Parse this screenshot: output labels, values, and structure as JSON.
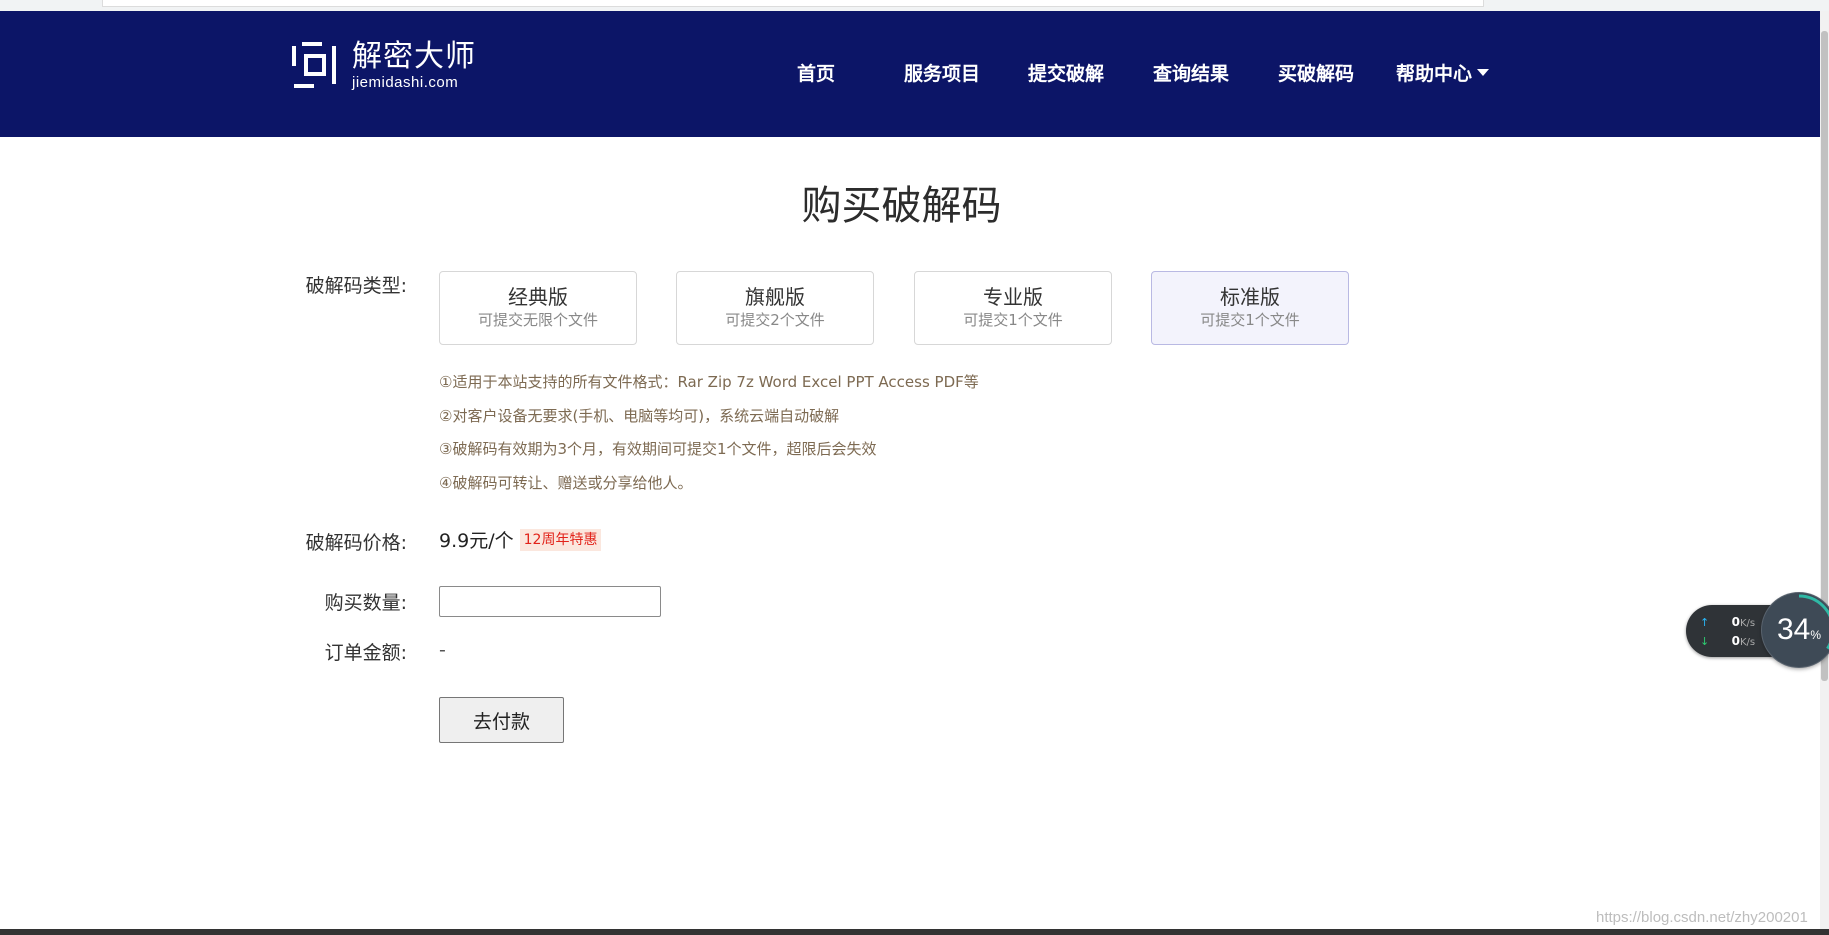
{
  "site": {
    "logo_cn": "解密大师",
    "logo_en": "jiemidashi.com"
  },
  "nav": {
    "items": [
      {
        "label": "首页"
      },
      {
        "label": "服务项目"
      },
      {
        "label": "提交破解"
      },
      {
        "label": "查询结果"
      },
      {
        "label": "买破解码"
      },
      {
        "label": "帮助中心"
      }
    ]
  },
  "page": {
    "title": "购买破解码"
  },
  "form": {
    "type_label": "破解码类型:",
    "types": [
      {
        "name": "经典版",
        "desc": "可提交无限个文件",
        "selected": false
      },
      {
        "name": "旗舰版",
        "desc": "可提交2个文件",
        "selected": false
      },
      {
        "name": "专业版",
        "desc": "可提交1个文件",
        "selected": false
      },
      {
        "name": "标准版",
        "desc": "可提交1个文件",
        "selected": true
      }
    ],
    "notes": [
      "①适用于本站支持的所有文件格式：Rar Zip 7z Word Excel PPT Access PDF等",
      "②对客户设备无要求(手机、电脑等均可)，系统云端自动破解",
      "③破解码有效期为3个月，有效期间可提交1个文件，超限后会失效",
      "④破解码可转让、赠送或分享给他人。"
    ],
    "price_label": "破解码价格:",
    "price_value": "9.9元/个",
    "price_badge": "12周年特惠",
    "quantity_label": "购买数量:",
    "quantity_value": "",
    "amount_label": "订单金额:",
    "amount_value": "-",
    "pay_button": "去付款"
  },
  "speed_widget": {
    "up_value": "0",
    "up_unit": "K/s",
    "down_value": "0",
    "down_unit": "K/s",
    "percent": "34",
    "percent_sign": "%"
  },
  "watermark": "https://blog.csdn.net/zhy200201",
  "colors": {
    "header_bg": "#0c1567",
    "badge_text": "#e2231a",
    "badge_bg": "#fbe7de",
    "note_text": "#7d6a52",
    "selected_card_bg": "#f3f3fc"
  }
}
